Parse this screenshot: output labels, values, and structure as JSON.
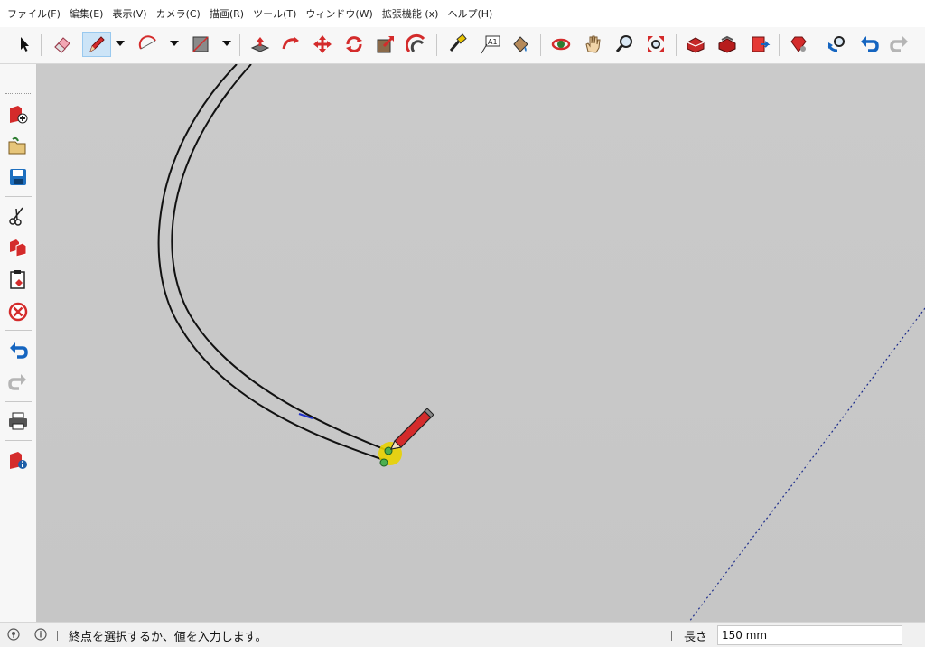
{
  "menu": {
    "items": [
      {
        "label": "ファイル(F)"
      },
      {
        "label": "編集(E)"
      },
      {
        "label": "表示(V)"
      },
      {
        "label": "カメラ(C)"
      },
      {
        "label": "描画(R)"
      },
      {
        "label": "ツール(T)"
      },
      {
        "label": "ウィンドウ(W)"
      },
      {
        "label": "拡張機能 (x)"
      },
      {
        "label": "ヘルプ(H)"
      }
    ]
  },
  "toolbar": {
    "tools": [
      "select-arrow-icon",
      "eraser-icon",
      "pencil-line-icon",
      "arc-icon",
      "rectangle-icon",
      "push-pull-icon",
      "follow-me-icon",
      "move-icon",
      "rotate-icon",
      "scale-icon",
      "offset-icon",
      "tape-measure-icon",
      "text-icon",
      "paint-bucket-icon",
      "orbit-icon",
      "pan-hand-icon",
      "zoom-icon",
      "zoom-extents-icon",
      "warehouse-icon",
      "share-model-icon",
      "extension-warehouse-icon",
      "ruby-icon",
      "previous-view-icon",
      "undo-icon",
      "redo-icon"
    ],
    "active_tool": "pencil-line-icon"
  },
  "left_toolbar": {
    "tools": [
      "new-icon",
      "open-icon",
      "save-icon",
      "cut-icon",
      "copy-icon",
      "paste-icon",
      "delete-icon",
      "undo-icon",
      "redo-icon",
      "print-icon",
      "model-info-icon"
    ]
  },
  "colors": {
    "accent_red": "#d42b2b",
    "active_tool_bg": "#cce4f7",
    "viewport_bg": "#c8c8c8",
    "inference_yellow": "#e8d200",
    "axis_blue": "#2233cc"
  },
  "status": {
    "message": "終点を選択するか、値を入力します。",
    "measurement_label": "長さ",
    "measurement_value": "150 mm"
  }
}
